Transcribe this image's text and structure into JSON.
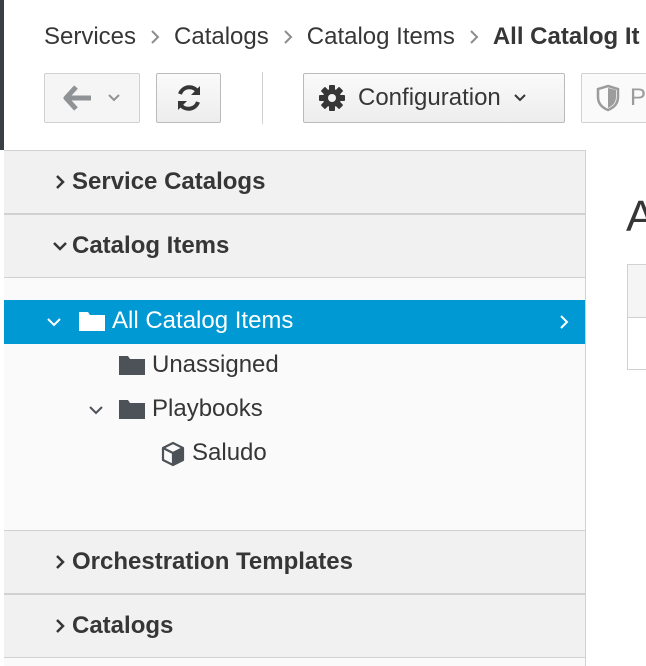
{
  "breadcrumb": {
    "items": [
      "Services",
      "Catalogs",
      "Catalog Items",
      "All Catalog It"
    ]
  },
  "toolbar": {
    "back_icon": "arrow-left-icon",
    "refresh_icon": "refresh-icon",
    "configuration_label": "Configuration",
    "policy_label": "P"
  },
  "sidebar": {
    "sections": [
      {
        "title": "Service Catalogs",
        "expanded": false
      },
      {
        "title": "Catalog Items",
        "expanded": true
      },
      {
        "title": "Orchestration Templates",
        "expanded": false
      },
      {
        "title": "Catalogs",
        "expanded": false
      }
    ],
    "tree": [
      {
        "label": "All Catalog Items",
        "icon": "folder-icon",
        "selected": true,
        "expanded": true
      },
      {
        "label": "Unassigned",
        "icon": "folder-icon",
        "selected": false
      },
      {
        "label": "Playbooks",
        "icon": "folder-icon",
        "selected": false,
        "expanded": true
      },
      {
        "label": "Saludo",
        "icon": "cube-icon",
        "selected": false
      }
    ]
  },
  "main": {
    "title": "A"
  },
  "colors": {
    "selected_row": "#0099d3",
    "accordion_header": "#f1f1f1",
    "text": "#363636"
  }
}
